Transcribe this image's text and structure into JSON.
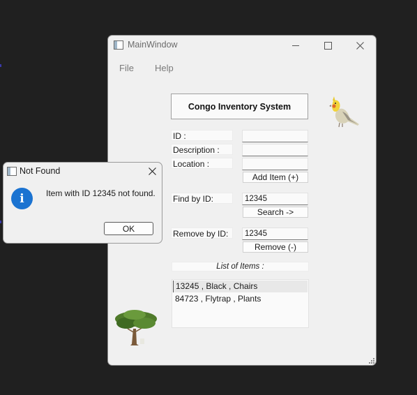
{
  "main_window": {
    "title": "MainWindow",
    "menu": [
      "File",
      "Help"
    ],
    "app_title": "Congo Inventory System",
    "labels": {
      "id": "ID :",
      "description": "Description :",
      "location": "Location :",
      "find": "Find by ID:",
      "remove": "Remove by ID:"
    },
    "inputs": {
      "id": "",
      "description": "",
      "location": "",
      "find": "12345",
      "remove": "12345"
    },
    "buttons": {
      "add": "Add Item (+)",
      "search": "Search ->",
      "remove": "Remove (-)"
    },
    "list_label": "List of Items :",
    "list_items": [
      "13245 , Black , Chairs",
      "84723 , Flytrap , Plants"
    ]
  },
  "dialog": {
    "title": "Not Found",
    "message": "Item with ID 12345 not found.",
    "ok": "OK"
  },
  "colors": {
    "desktop": "#202020",
    "window_bg": "#f0f0f0",
    "info_blue": "#1b73d1"
  },
  "icons": [
    "app-icon",
    "minimize-icon",
    "maximize-icon",
    "close-icon",
    "cockatiel-image",
    "tree-image",
    "info-icon",
    "resize-grip-icon"
  ]
}
